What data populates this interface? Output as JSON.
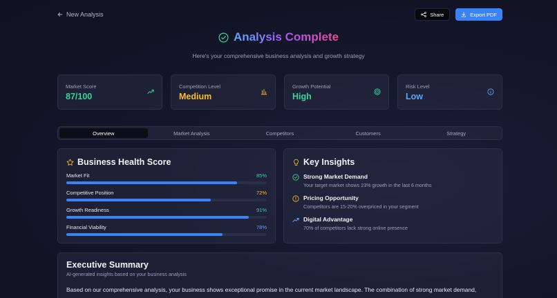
{
  "nav": {
    "back_label": "New Analysis"
  },
  "toolbar": {
    "share_label": "Share",
    "export_label": "Export PDF"
  },
  "hero": {
    "title": "Analysis Complete",
    "subtitle": "Here's your comprehensive business analysis and growth strategy"
  },
  "metrics": [
    {
      "label": "Market Score",
      "value": "87/100",
      "color": "#34d399",
      "icon": "trending-up-icon"
    },
    {
      "label": "Competition Level",
      "value": "Medium",
      "color": "#fbbf24",
      "icon": "bar-chart-icon"
    },
    {
      "label": "Growth Potential",
      "value": "High",
      "color": "#34d399",
      "icon": "target-icon"
    },
    {
      "label": "Risk Level",
      "value": "Low",
      "color": "#60a5fa",
      "icon": "info-icon"
    }
  ],
  "tabs": [
    "Overview",
    "Market Analysis",
    "Competitors",
    "Customers",
    "Strategy"
  ],
  "active_tab": "Overview",
  "health": {
    "title": "Business Health Score",
    "items": [
      {
        "label": "Market Fit",
        "pct": "85%",
        "value": 85,
        "color": "#34d399"
      },
      {
        "label": "Competitive Position",
        "pct": "72%",
        "value": 72,
        "color": "#fbbf24"
      },
      {
        "label": "Growth Readiness",
        "pct": "91%",
        "value": 91,
        "color": "#34d399"
      },
      {
        "label": "Financial Viability",
        "pct": "78%",
        "value": 78,
        "color": "#60a5fa"
      }
    ]
  },
  "insights": {
    "title": "Key Insights",
    "items": [
      {
        "title": "Strong Market Demand",
        "desc": "Your target market shows 23% growth in the last 6 months",
        "icon": "check-circle-icon",
        "color": "#34d399"
      },
      {
        "title": "Pricing Opportunity",
        "desc": "Competitors are 15-20% overpriced in your segment",
        "icon": "alert-circle-icon",
        "color": "#fbbf24"
      },
      {
        "title": "Digital Advantage",
        "desc": "70% of competitors lack strong online presence",
        "icon": "trending-up-icon",
        "color": "#60a5fa"
      }
    ]
  },
  "summary": {
    "title": "Executive Summary",
    "subtitle": "AI-generated insights based on your business analysis",
    "body": "Based on our comprehensive analysis, your business shows exceptional promise in the current market landscape. The combination of strong market demand,"
  },
  "colors": {
    "accent": "#3b82f6",
    "green": "#34d399",
    "amber": "#fbbf24",
    "blue": "#60a5fa"
  }
}
